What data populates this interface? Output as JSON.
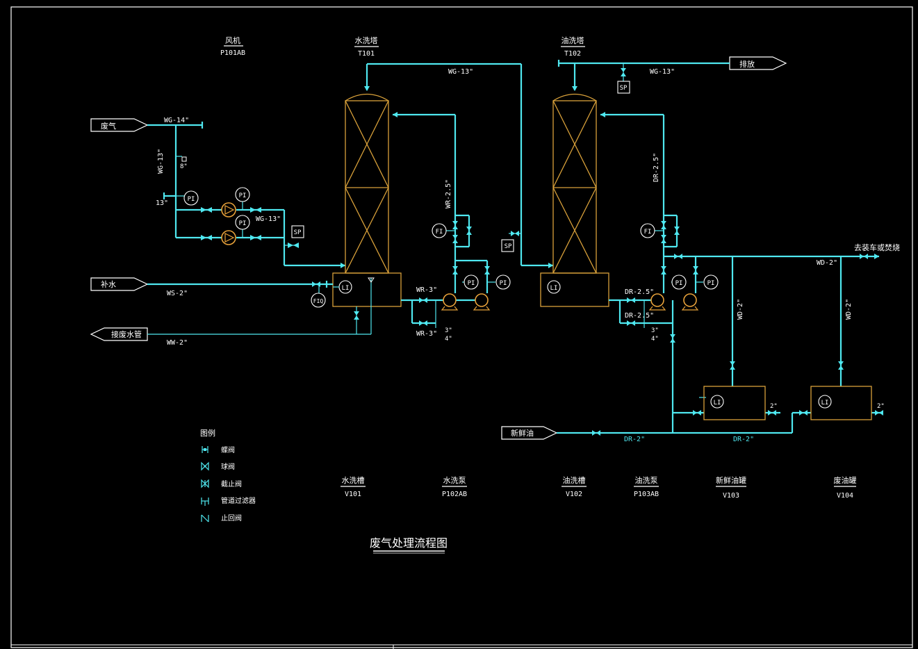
{
  "title": "废气处理流程图",
  "equipment": {
    "fan": {
      "name": "风机",
      "tag": "P101AB"
    },
    "water_tower": {
      "name": "水洗塔",
      "tag": "T101"
    },
    "oil_tower": {
      "name": "油洗塔",
      "tag": "T102"
    },
    "water_tank": {
      "name": "水洗槽",
      "tag": "V101"
    },
    "water_pump": {
      "name": "水洗泵",
      "tag": "P102AB"
    },
    "oil_tank": {
      "name": "油洗槽",
      "tag": "V102"
    },
    "oil_pump": {
      "name": "油洗泵",
      "tag": "P103AB"
    },
    "fresh_oil_tank": {
      "name": "新鲜油罐",
      "tag": "V103"
    },
    "waste_oil_tank": {
      "name": "废油罐",
      "tag": "V104"
    }
  },
  "streams": {
    "waste_gas": "废气",
    "makeup_water": "补水",
    "to_wastewater": "接废水管",
    "fresh_oil": "新鲜油",
    "discharge": "排放",
    "to_truck": "去装车或焚烧"
  },
  "lines": {
    "wg14": "WG-14\"",
    "wg13": "WG-13\"",
    "ws2": "WS-2\"",
    "ww2": "WW-2\"",
    "wr25": "WR-2.5\"",
    "wr3": "WR-3\"",
    "dr25": "DR-2.5\"",
    "dr2": "DR-2\"",
    "wd2": "WD-2\"",
    "s13": "13\"",
    "s8": "8\"",
    "s3": "3\"",
    "s4": "4\"",
    "s2": "2\""
  },
  "instruments": {
    "pi": "PI",
    "fi": "FI",
    "fiq": "FIQ",
    "li": "LI",
    "sp": "SP"
  },
  "legend": {
    "title": "图例",
    "items": [
      {
        "icon": "butterfly-valve",
        "label": "蝶阀"
      },
      {
        "icon": "ball-valve",
        "label": "球阀"
      },
      {
        "icon": "globe-valve",
        "label": "截止阀"
      },
      {
        "icon": "pipeline-filter",
        "label": "管道过滤器"
      },
      {
        "icon": "check-valve",
        "label": "止回阀"
      }
    ]
  },
  "colors": {
    "background": "#000000",
    "pipe": "#4fe8f0",
    "vessel": "#d9a13a",
    "text": "#ffffff"
  }
}
